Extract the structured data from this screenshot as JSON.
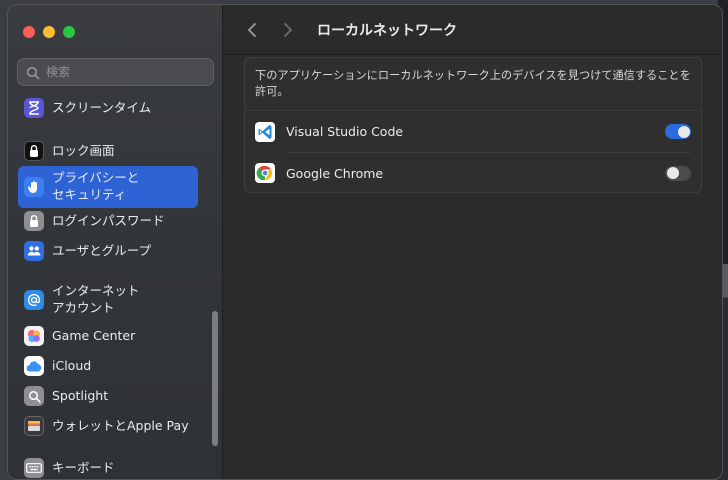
{
  "search": {
    "placeholder": "検索"
  },
  "sidebar": {
    "items": [
      {
        "label": "スクリーンタイム",
        "icon": "hourglass-icon",
        "color": "#5b56d6"
      },
      {
        "label": "ロック画面",
        "icon": "lock-screen-icon",
        "color": "#1c1c1e"
      },
      {
        "label": "プライバシーと\nセキュリティ",
        "icon": "hand-icon",
        "color": "#2f6fe4",
        "active": true
      },
      {
        "label": "ログインパスワード",
        "icon": "padlock-icon",
        "color": "#8e8e93"
      },
      {
        "label": "ユーザとグループ",
        "icon": "users-icon",
        "color": "#2f6fe4"
      },
      {
        "label": "インターネット\nアカウント",
        "icon": "at-icon",
        "color": "#2f8ce4"
      },
      {
        "label": "Game Center",
        "icon": "game-center-icon",
        "color": "#e0e0e0"
      },
      {
        "label": "iCloud",
        "icon": "icloud-icon",
        "color": "#ffffff"
      },
      {
        "label": "Spotlight",
        "icon": "spotlight-icon",
        "color": "#8e8e93"
      },
      {
        "label": "ウォレットとApple Pay",
        "icon": "wallet-icon",
        "color": "#3a3a3c"
      },
      {
        "label": "キーボード",
        "icon": "keyboard-icon",
        "color": "#8e8e93"
      }
    ]
  },
  "header": {
    "title": "ローカルネットワーク"
  },
  "main": {
    "description": "下のアプリケーションにローカルネットワーク上のデバイスを見つけて通信することを許可。",
    "apps": [
      {
        "name": "Visual Studio Code",
        "icon": "vscode-icon",
        "enabled": true
      },
      {
        "name": "Google Chrome",
        "icon": "chrome-icon",
        "enabled": false
      }
    ]
  },
  "colors": {
    "accent": "#2e63d6",
    "toggle_on": "#2b6be0"
  }
}
